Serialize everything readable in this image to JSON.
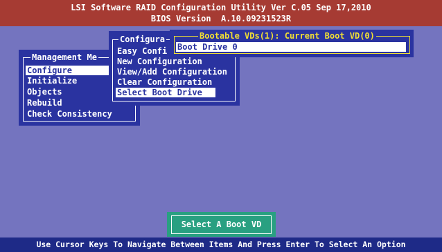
{
  "header": {
    "line1": "LSI Software RAID Configuration Utility Ver C.05 Sep 17,2010",
    "line2": "BIOS Version  A.10.09231523R"
  },
  "management_menu": {
    "title": "Management Me",
    "items": [
      "Configure",
      "Initialize",
      "Objects",
      "Rebuild",
      "Check Consistency"
    ],
    "selected_index": 0
  },
  "configure_menu": {
    "title": "Configura",
    "items": [
      "Easy Confi",
      "New Configuration",
      "View/Add Configuration",
      "Clear Configuration",
      "Select Boot Drive"
    ],
    "selected_index": 4
  },
  "boot_menu": {
    "title": "Bootable VDs(1): Current Boot VD(0)",
    "items": [
      "Boot Drive 0"
    ],
    "selected_index": 0
  },
  "status_box": {
    "label": "Select A Boot VD"
  },
  "footer": {
    "hint": "Use Cursor Keys To Navigate Between Items And Press Enter To Select An Option"
  },
  "colors": {
    "background": "#7474bf",
    "header": "#a63b33",
    "panel": "#2a33a0",
    "footer": "#1e2a87",
    "status_box": "#29a081",
    "boot_border": "#f2e033"
  }
}
